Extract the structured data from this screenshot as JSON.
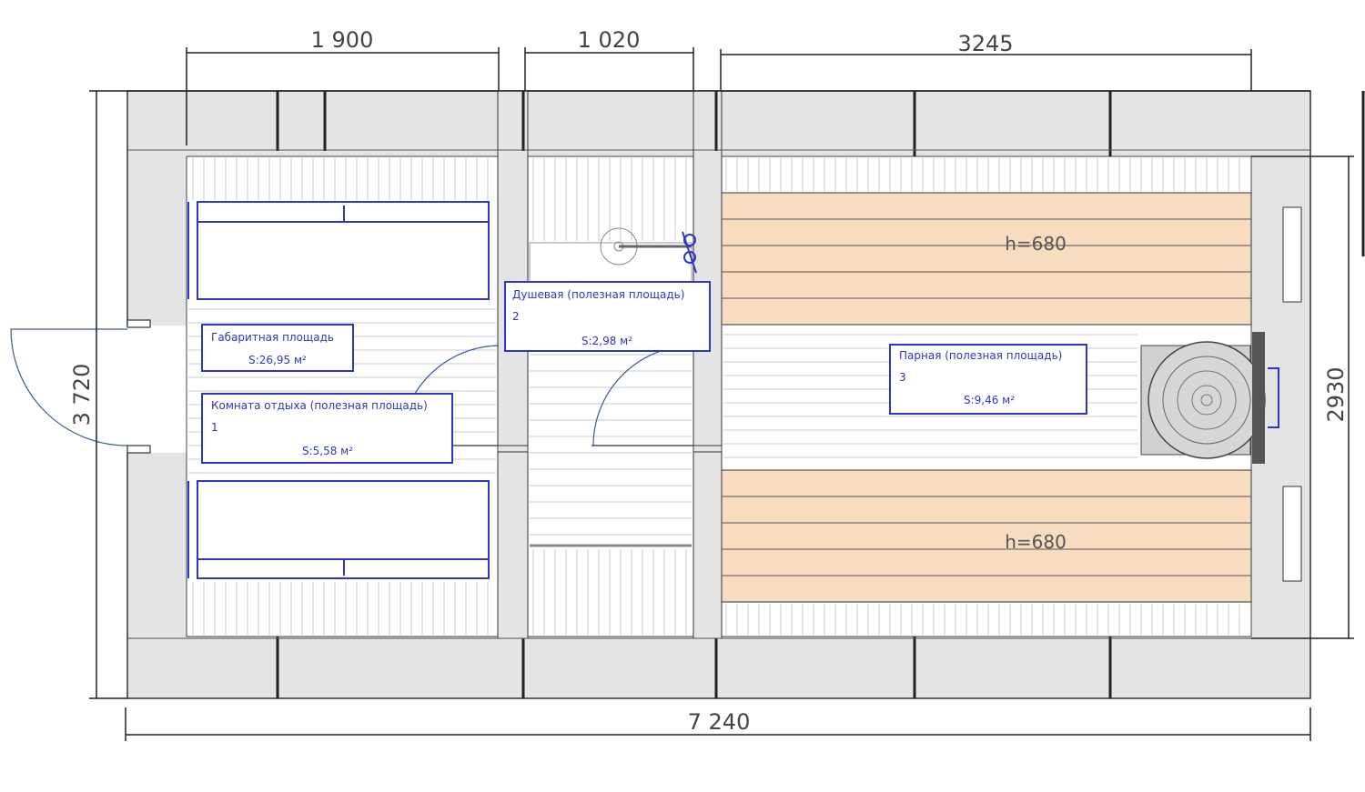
{
  "dimensions": {
    "top_left": "1 900",
    "top_middle": "1 020",
    "top_right": "3245",
    "left_total": "3 720",
    "right_inner": "2930",
    "bottom_total": "7 240"
  },
  "rooms": {
    "gross": {
      "title": "Габаритная площадь",
      "area": "S:26,95 м²"
    },
    "rest": {
      "title": "Комната отдыха (полезная площадь)",
      "number": "1",
      "area": "S:5,58 м²"
    },
    "shower": {
      "title": "Душевая (полезная площадь)",
      "number": "2",
      "area": "S:2,98 м²"
    },
    "steam": {
      "title": "Парная (полезная площадь)",
      "number": "3",
      "area": "S:9,46 м²"
    }
  },
  "benches": {
    "upper": "h=680",
    "lower": "h=680"
  },
  "colors": {
    "label_blue": "#2d36c8",
    "bench_fill": "#f8dcc0",
    "wall_fill": "#e4e4e4",
    "dim_line": "#222222"
  }
}
